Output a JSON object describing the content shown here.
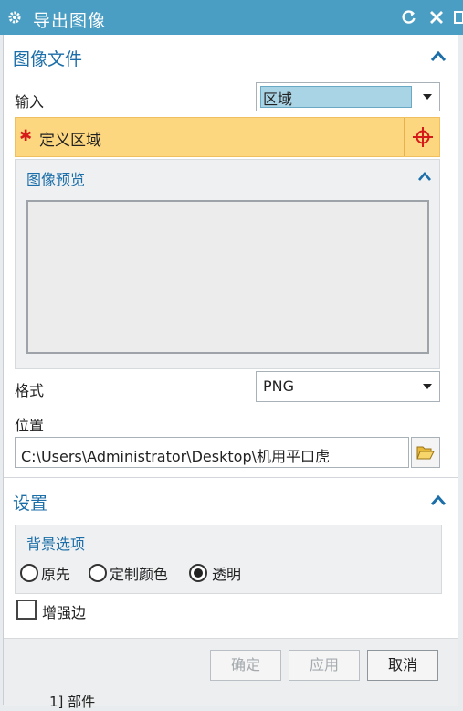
{
  "titlebar": {
    "title": "导出图像",
    "icons": [
      "gear-icon",
      "reset-icon",
      "close-icon"
    ]
  },
  "image_file": {
    "section_title": "图像文件",
    "input_label": "输入",
    "input_value": "区域",
    "define_region_label": "定义区域",
    "required_mark": "✱",
    "preview_title": "图像预览",
    "format_label": "格式",
    "format_value": "PNG",
    "location_label": "位置",
    "location_value": "C:\\Users\\Administrator\\Desktop\\机用平口虎"
  },
  "settings": {
    "section_title": "设置",
    "background_group_title": "背景选项",
    "radio_options": [
      {
        "label": "原先",
        "selected": false
      },
      {
        "label": "定制颜色",
        "selected": false
      },
      {
        "label": "透明",
        "selected": true
      }
    ],
    "enhance_edges_label": "增强边",
    "enhance_edges_checked": false
  },
  "footer": {
    "ok_label": "确定",
    "apply_label": "应用",
    "cancel_label": "取消",
    "background_tree_text": "1] 部件"
  },
  "colors": {
    "titlebar_bg": "#4a9ec4",
    "section_title": "#1b6ea8",
    "highlight_row": "#fdd680",
    "input_combo_bg": "#a9d4e6",
    "required_star": "#d61a1a"
  }
}
